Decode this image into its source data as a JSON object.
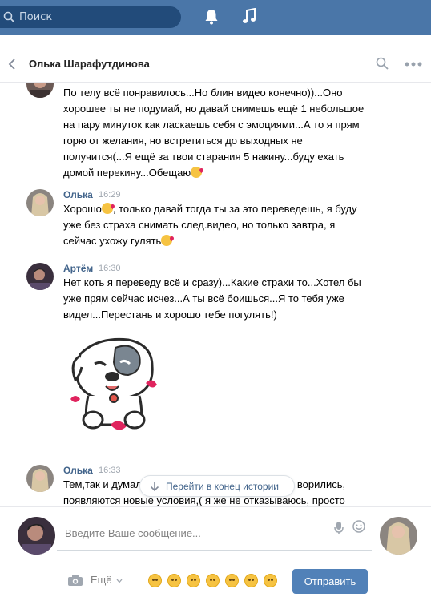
{
  "topbar": {
    "search_placeholder": "Поиск",
    "icons": [
      "search-icon",
      "bell-icon",
      "music-icon"
    ],
    "background": "#4a76a8"
  },
  "chat": {
    "title": "Олька Шарафутдинова"
  },
  "messages": [
    {
      "author": "",
      "time": "",
      "lines": [
        "По телу всё понравилось...Но блин видео конечно))...Оно",
        "хорошее ты не подумай, но давай снимешь ещё 1 небольшое",
        "на пару минуток как ласкаешь себя с эмоциями...А то я прям",
        "горю от желания, но встретиться до выходных не",
        "получится(...Я ещё за твои старания 5 накину...буду ехать",
        "домой перекину...Обещаю"
      ]
    },
    {
      "author": "Олька",
      "time": "16:29",
      "lines": [
        "Хорошо",
        ", только давай тогда ты за это переведешь, я буду",
        "уже без страха снимать след.видео, но только завтра, я",
        "сейчас ухожу гулять"
      ]
    },
    {
      "author": "Артём",
      "time": "16:30",
      "lines": [
        "Нет коть я переведу всё и сразу)...Какие страхи то...Хотел бы",
        "уже прям сейчас исчез...А ты всё боишься...Я то тебя уже",
        "видел...Перестань и хорошо тебе погулять!)"
      ]
    },
    {
      "author": "Олька",
      "time": "16:33",
      "lines": [
        "Тем,так и думал",
        "ворились,",
        "появляются новые условия,( я же не отказываюсь, просто"
      ]
    }
  ],
  "jump": {
    "label": "Перейти в конец истории"
  },
  "composer": {
    "placeholder": "Введите Ваше сообщение...",
    "more_label": "Ещё",
    "send_label": "Отправить",
    "accent": "#5181b8"
  }
}
